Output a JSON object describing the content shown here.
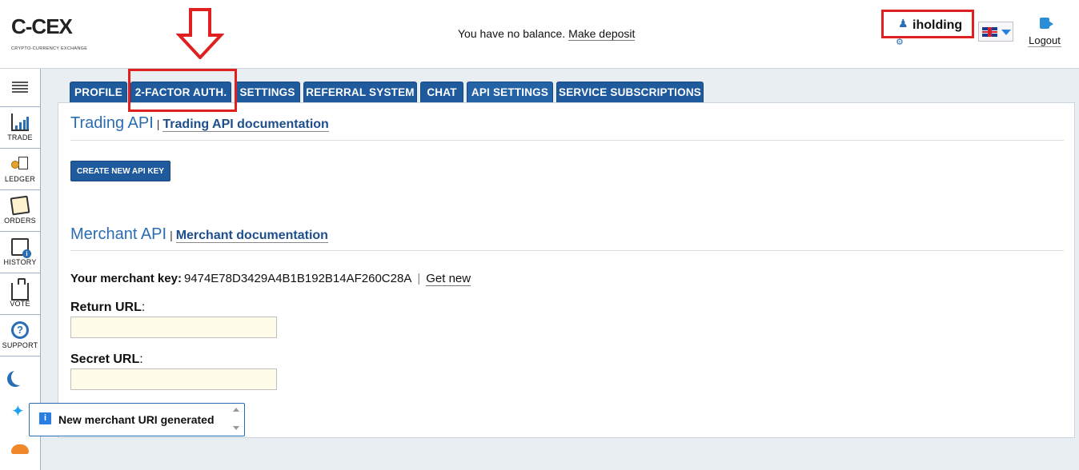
{
  "header": {
    "logo_text": "C-CEX",
    "logo_subtitle": "CRYPTO-CURRENCY EXCHANGE",
    "balance_text": "You have no balance.",
    "deposit_link": "Make deposit",
    "username": "iholding",
    "user_icon": "user-icon",
    "settings_icon": "gear-icon",
    "language_flag": "uk-flag-icon",
    "logout_label": "Logout"
  },
  "sidebar": {
    "items": [
      {
        "label": "TRADE",
        "icon": "trade-chart-icon"
      },
      {
        "label": "LEDGER",
        "icon": "ledger-icon"
      },
      {
        "label": "ORDERS",
        "icon": "orders-icon"
      },
      {
        "label": "HISTORY",
        "icon": "history-icon"
      },
      {
        "label": "VOTE",
        "icon": "vote-icon"
      },
      {
        "label": "SUPPORT",
        "icon": "support-icon"
      }
    ],
    "extras": [
      "moon-icon",
      "twitter-icon",
      "cloud-icon"
    ]
  },
  "tabs": [
    {
      "label": "PROFILE"
    },
    {
      "label": "2-FACTOR AUTH."
    },
    {
      "label": "SETTINGS"
    },
    {
      "label": "REFERRAL SYSTEM"
    },
    {
      "label": "CHAT"
    },
    {
      "label": "API SETTINGS",
      "active": true
    },
    {
      "label": "SERVICE SUBSCRIPTIONS"
    }
  ],
  "trading_api": {
    "title": "Trading API",
    "separator": "|",
    "doc_link": "Trading API documentation",
    "create_button": "CREATE NEW API KEY"
  },
  "merchant_api": {
    "title": "Merchant API",
    "separator": "|",
    "doc_link": "Merchant documentation",
    "key_label": "Your merchant key:",
    "key_value": "9474E78D3429A4B1B192B14AF260C28A",
    "key_separator": "|",
    "get_new": "Get new",
    "return_url_label": "Return URL",
    "return_url_value": "",
    "secret_url_label": "Secret URL",
    "secret_url_value": "",
    "label_colon": ":"
  },
  "toast": {
    "icon": "info-icon",
    "message": "New merchant URI generated"
  },
  "colors": {
    "tab_blue": "#1e5a9c",
    "link_blue": "#2a6db5",
    "highlight_red": "#e02020",
    "input_bg": "#fffde9"
  }
}
